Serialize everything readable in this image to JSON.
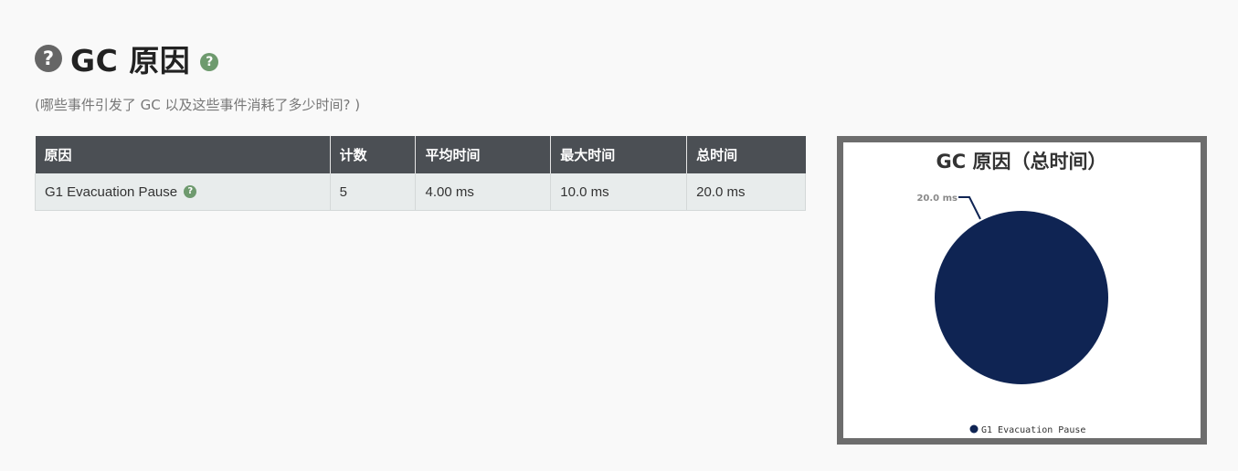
{
  "header": {
    "help_icon": "question-circle-icon",
    "title": "GC 原因",
    "title_help_icon": "question-circle-icon",
    "subtitle": "(哪些事件引发了 GC 以及这些事件消耗了多少时间? )"
  },
  "table": {
    "columns": [
      "原因",
      "计数",
      "平均时间",
      "最大时间",
      "总时间"
    ],
    "rows": [
      {
        "cause": "G1 Evacuation Pause",
        "count": "5",
        "avg_time": "4.00 ms",
        "max_time": "10.0 ms",
        "total_time": "20.0 ms"
      }
    ]
  },
  "colors": {
    "header_bg": "#4b4f54",
    "row_bg": "#e8ecec",
    "pie_slice": "#0f2453",
    "chart_border": "#6d6d6d",
    "help_icon_green": "#6e9a6e"
  },
  "chart_data": {
    "type": "pie",
    "title": "GC 原因（总时间）",
    "categories": [
      "G1 Evacuation Pause"
    ],
    "values": [
      20.0
    ],
    "data_labels": [
      "20.0 ms"
    ],
    "legend": [
      "G1 Evacuation Pause"
    ],
    "legend_position": "bottom"
  }
}
